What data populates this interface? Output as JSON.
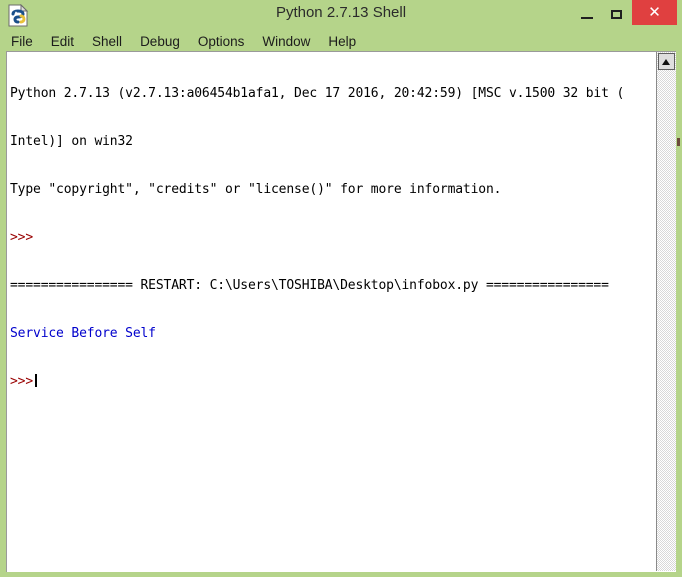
{
  "window": {
    "title": "Python 2.7.13 Shell",
    "icon": "python-idle-icon",
    "frame_color": "#b5d48a",
    "controls": {
      "minimize": "–",
      "maximize": "☐",
      "close": "✕",
      "close_color": "#e04040"
    }
  },
  "menubar": {
    "items": [
      {
        "label": "File"
      },
      {
        "label": "Edit"
      },
      {
        "label": "Shell"
      },
      {
        "label": "Debug"
      },
      {
        "label": "Options"
      },
      {
        "label": "Window"
      },
      {
        "label": "Help"
      }
    ]
  },
  "shell": {
    "colors": {
      "prompt": "#990000",
      "output": "#0000cc",
      "text": "#000000",
      "background": "#ffffff"
    },
    "lines": [
      {
        "text": "Python 2.7.13 (v2.7.13:a06454b1afa1, Dec 17 2016, 20:42:59) [MSC v.1500 32 bit (",
        "style": "text"
      },
      {
        "text": "Intel)] on win32",
        "style": "text"
      },
      {
        "text": "Type \"copyright\", \"credits\" or \"license()\" for more information.",
        "style": "text"
      },
      {
        "text": ">>>",
        "style": "prompt"
      },
      {
        "text": "================ RESTART: C:\\Users\\TOSHIBA\\Desktop\\infobox.py ================",
        "style": "text"
      },
      {
        "text": "Service Before Self",
        "style": "output"
      },
      {
        "text": ">>>",
        "style": "prompt",
        "caret": true
      }
    ]
  },
  "scrollbar": {
    "up_arrow": "scroll-up-arrow",
    "orientation": "vertical"
  }
}
